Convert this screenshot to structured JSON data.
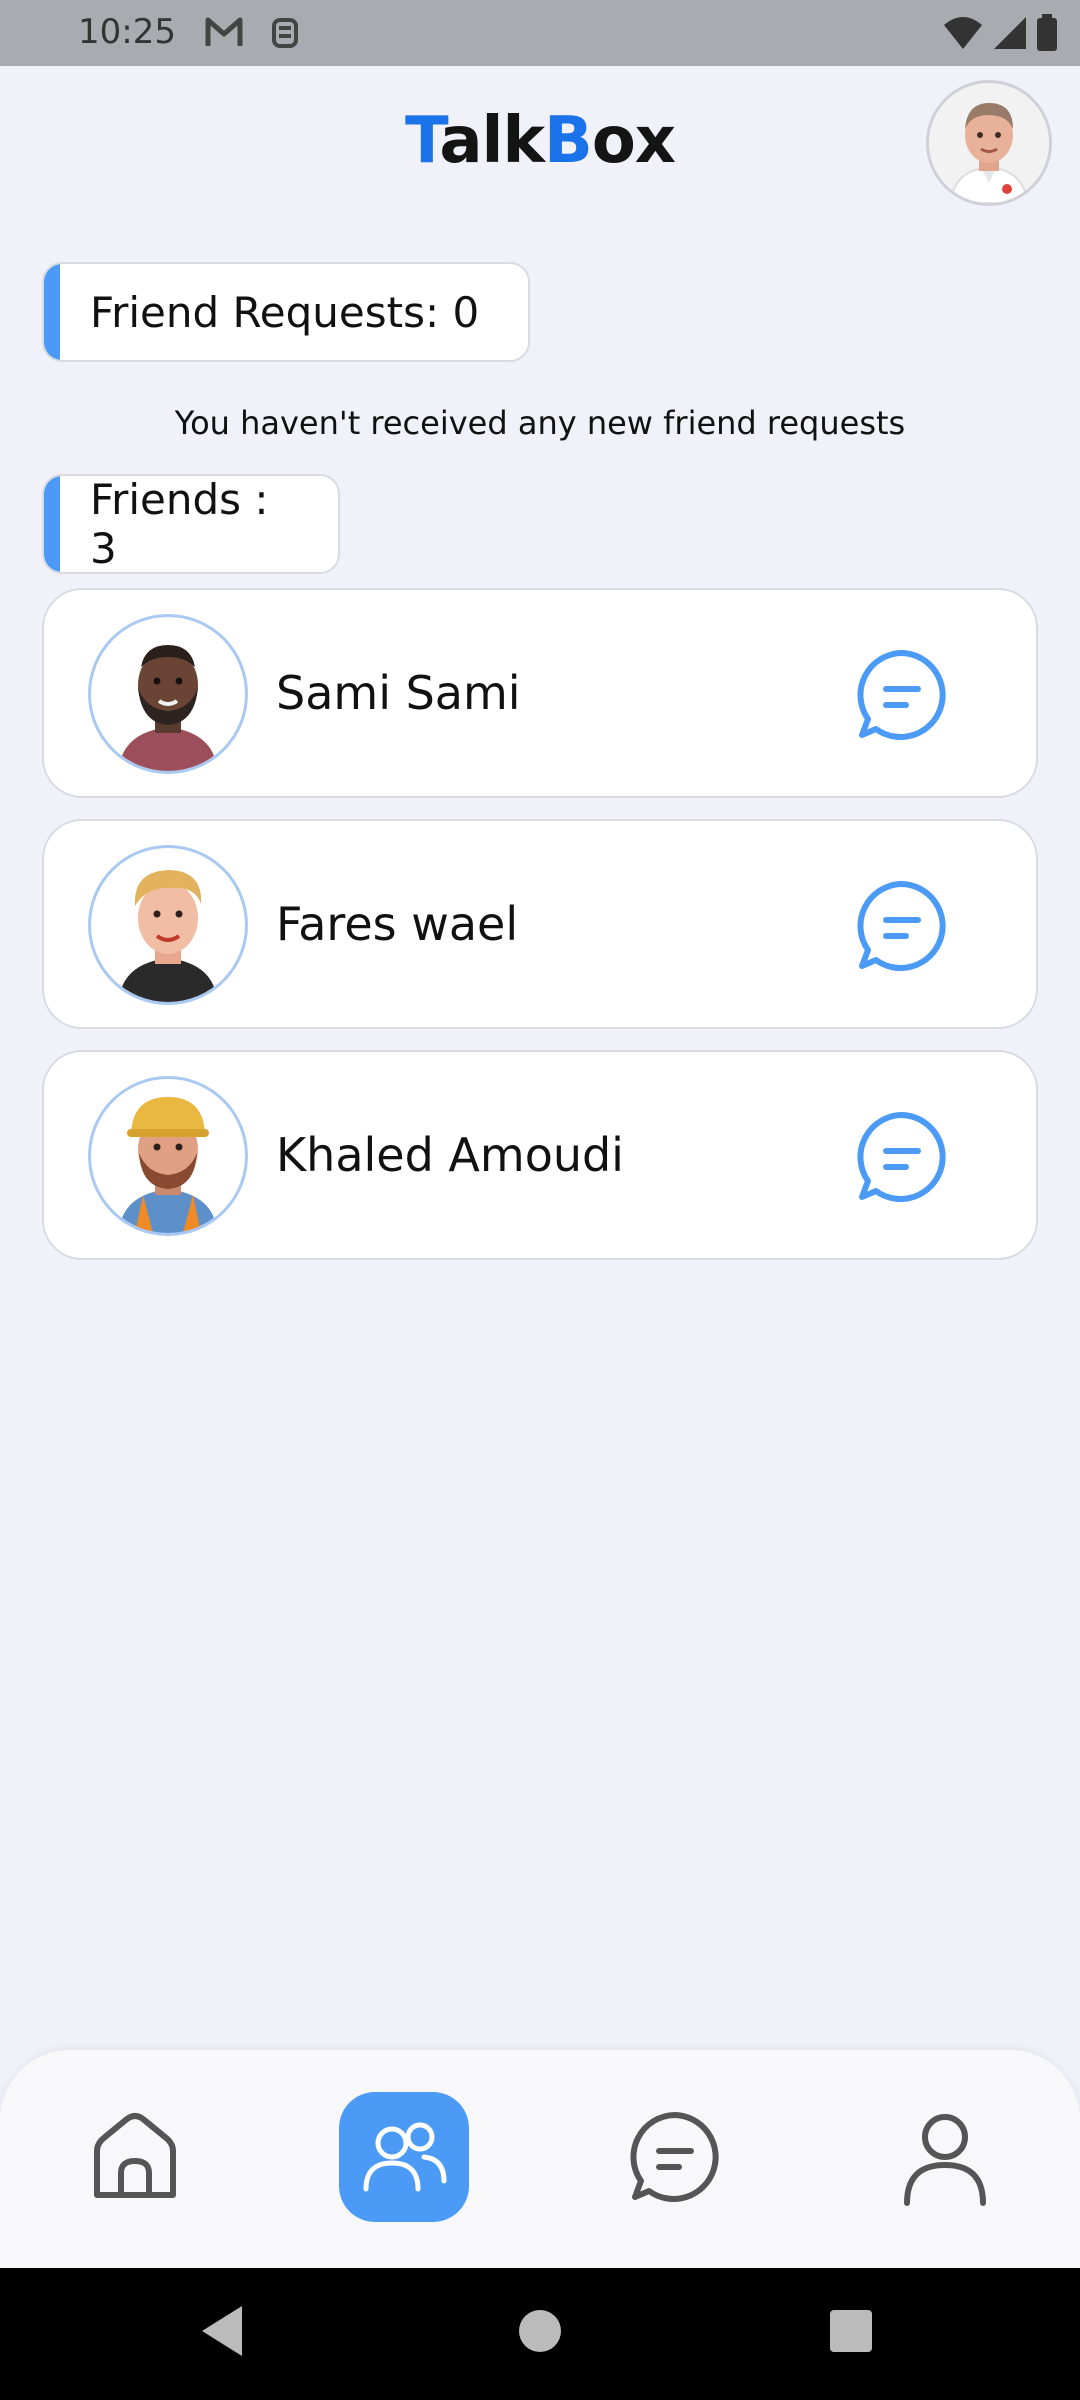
{
  "status_bar": {
    "time": "10:25",
    "left_icons": [
      "gmail-icon",
      "notification-icon"
    ],
    "right_icons": [
      "wifi-icon",
      "signal-icon",
      "battery-icon"
    ]
  },
  "header": {
    "brand_first_letter": "T",
    "brand_first_rest": "alk",
    "brand_second_letter": "B",
    "brand_second_rest": "ox",
    "accent_color": "#1a73e8",
    "profile_avatar_icon": "user-avatar-icon"
  },
  "friend_requests": {
    "label": "Friend Requests: 0",
    "empty_message": "You haven't received any new friend requests"
  },
  "friends": {
    "label": "Friends : 3",
    "items": [
      {
        "name": "Sami Sami",
        "avatar_icon": "avatar-icon",
        "action_icon": "chat-icon"
      },
      {
        "name": "Fares wael",
        "avatar_icon": "avatar-icon",
        "action_icon": "chat-icon"
      },
      {
        "name": "Khaled Amoudi",
        "avatar_icon": "avatar-icon",
        "action_icon": "chat-icon"
      }
    ]
  },
  "bottom_nav": {
    "items": [
      {
        "icon": "home-icon",
        "active": false
      },
      {
        "icon": "friends-icon",
        "active": true
      },
      {
        "icon": "chat-icon",
        "active": false
      },
      {
        "icon": "profile-icon",
        "active": false
      }
    ],
    "active_color": "#4b9bf6"
  },
  "system_nav": {
    "items": [
      "back-icon",
      "home-circle-icon",
      "recents-icon"
    ]
  }
}
